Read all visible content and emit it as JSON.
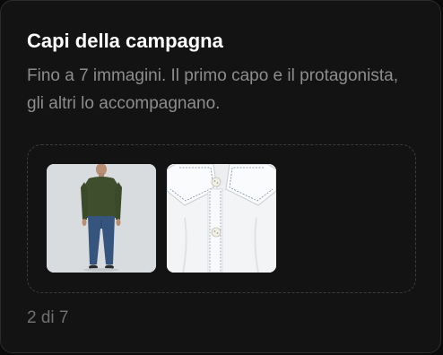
{
  "card": {
    "title": "Capi della campagna",
    "description": "Fino a 7 immagini. Il primo capo e il protagonista, gli altri lo accompagnano.",
    "images": [
      {
        "name": "model-green-sweater-jeans"
      },
      {
        "name": "white-shirt-closeup"
      }
    ],
    "counter": "2 di 7"
  }
}
